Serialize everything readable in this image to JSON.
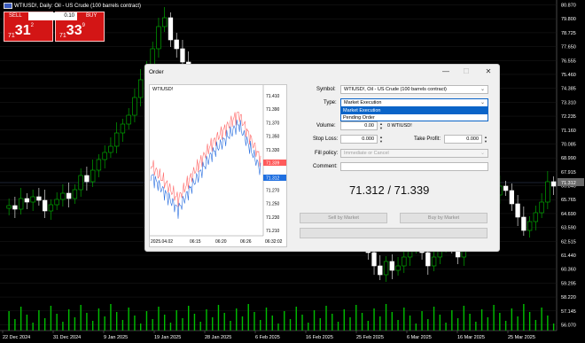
{
  "chart": {
    "title": "WTIUSD!, Daily:  Oil - US Crude (100 barrels contract)",
    "price_axis": [
      "80.870",
      "79.800",
      "78.725",
      "77.650",
      "76.555",
      "75.460",
      "74.385",
      "73.310",
      "72.235",
      "71.160",
      "70.085",
      "68.990",
      "67.915",
      "66.840",
      "65.765",
      "64.690",
      "63.590",
      "62.515",
      "61.440",
      "60.360",
      "59.295",
      "58.220",
      "57.145",
      "56.070",
      "54.980"
    ],
    "price_axis_labels": [
      "80.870",
      "79.800",
      "78.725",
      "77.650",
      "76.555",
      "75.460",
      "74.385",
      "73.310",
      "72.235",
      "71.160",
      "70.085",
      "68.990",
      "67.915",
      "66.840",
      "65.765",
      "64.690",
      "63.590",
      "62.515",
      "61.440",
      "60.360",
      "59.295",
      "58.220",
      "57.145",
      "56.070",
      "54.980"
    ],
    "colors": {
      "bull": "#00c000",
      "bear": "#ffffff",
      "grid": "#2a2a2a",
      "volume": "#00c000"
    }
  },
  "toolbar": {
    "sell_label": "SELL",
    "buy_label": "BUY",
    "volume": "0.10",
    "sell_price": {
      "small": "71",
      "big": "31",
      "sup": "2"
    },
    "buy_price": {
      "small": "71",
      "big": "33",
      "sup": "9"
    }
  },
  "dialog": {
    "title": "Order",
    "mini_chart": {
      "symbol_label": "WTIUSD!"
    },
    "labels": {
      "symbol": "Symbol:",
      "type": "Type:",
      "volume": "Volume:",
      "stop_loss": "Stop Loss:",
      "take_profit": "Take Profit:",
      "fill_policy": "Fill policy:",
      "comment": "Comment:"
    },
    "symbol_value": "WTIUSD!, Oil - US Crude (100 barrels contract)",
    "type_value": "Market Execution",
    "type_options": [
      "Market Execution",
      "Pending Order"
    ],
    "volume_value": "0.00",
    "volume_unit": "0 WTIUSD!",
    "stop_loss_value": "0.000",
    "take_profit_value": "0.000",
    "fill_policy_value": "Immediate or Cancel",
    "comment_value": "",
    "prices": "71.312 / 71.339",
    "sell_button": "Sell by Market",
    "buy_button": "Buy by Market"
  }
}
